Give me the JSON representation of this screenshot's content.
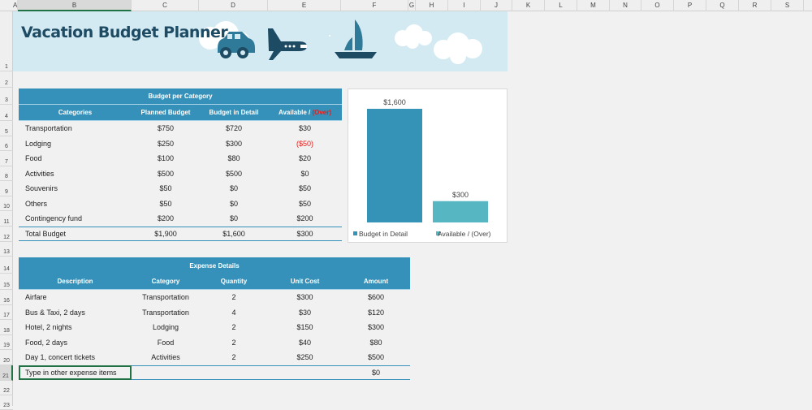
{
  "columns": [
    "A",
    "B",
    "C",
    "D",
    "E",
    "F",
    "G",
    "H",
    "I",
    "J",
    "K",
    "L",
    "M",
    "N",
    "O",
    "P",
    "Q",
    "R",
    "S"
  ],
  "rows": [
    "1",
    "2",
    "3",
    "4",
    "5",
    "6",
    "7",
    "8",
    "9",
    "10",
    "11",
    "12",
    "13",
    "14",
    "15",
    "16",
    "17",
    "18",
    "19",
    "20",
    "21",
    "22",
    "23"
  ],
  "title": "Vacation Budget Planner",
  "banner_icons": [
    "car-icon",
    "airplane-icon",
    "sailboat-icon",
    "cloud-icon"
  ],
  "budget": {
    "title": "Budget per Category",
    "headers": [
      "Categories",
      "Planned Budget",
      "Budget in Detail",
      "Available / ",
      "(Over)"
    ],
    "rows": [
      [
        "Transportation",
        "$750",
        "$720",
        "$30"
      ],
      [
        "Lodging",
        "$250",
        "$300",
        "($50)"
      ],
      [
        "Food",
        "$100",
        "$80",
        "$20"
      ],
      [
        "Activities",
        "$500",
        "$500",
        "$0"
      ],
      [
        "Souvenirs",
        "$50",
        "$0",
        "$50"
      ],
      [
        "Others",
        "$50",
        "$0",
        "$50"
      ],
      [
        "Contingency fund",
        "$200",
        "$0",
        "$200"
      ]
    ],
    "total": [
      "Total Budget",
      "$1,900",
      "$1,600",
      "$300"
    ]
  },
  "expenses": {
    "title": "Expense Details",
    "headers": [
      "Description",
      "Category",
      "Quantity",
      "Unit Cost",
      "Amount"
    ],
    "rows": [
      [
        "Airfare",
        "Transportation",
        "2",
        "$300",
        "$600"
      ],
      [
        "Bus & Taxi, 2 days",
        "Transportation",
        "4",
        "$30",
        "$120"
      ],
      [
        "Hotel, 2 nights",
        "Lodging",
        "2",
        "$150",
        "$300"
      ],
      [
        "Food, 2 days",
        "Food",
        "2",
        "$40",
        "$80"
      ],
      [
        "Day 1, concert tickets",
        "Activities",
        "2",
        "$250",
        "$500"
      ]
    ],
    "input_row": {
      "placeholder": "Type in other expense items",
      "amount": "$0"
    }
  },
  "colors": {
    "header": "#3591b9",
    "banner": "#d4eaf3",
    "title": "#1d4b63",
    "over": "#e0201e"
  },
  "chart_data": {
    "type": "bar",
    "categories": [
      "Budget in Detail",
      "Available / (Over)"
    ],
    "values": [
      1600,
      300
    ],
    "labels": [
      "$1,600",
      "$300"
    ],
    "colors": [
      "#3593b8",
      "#56b6c1"
    ],
    "legend": "bottom",
    "grid": false,
    "ylim": [
      0,
      1600
    ]
  }
}
